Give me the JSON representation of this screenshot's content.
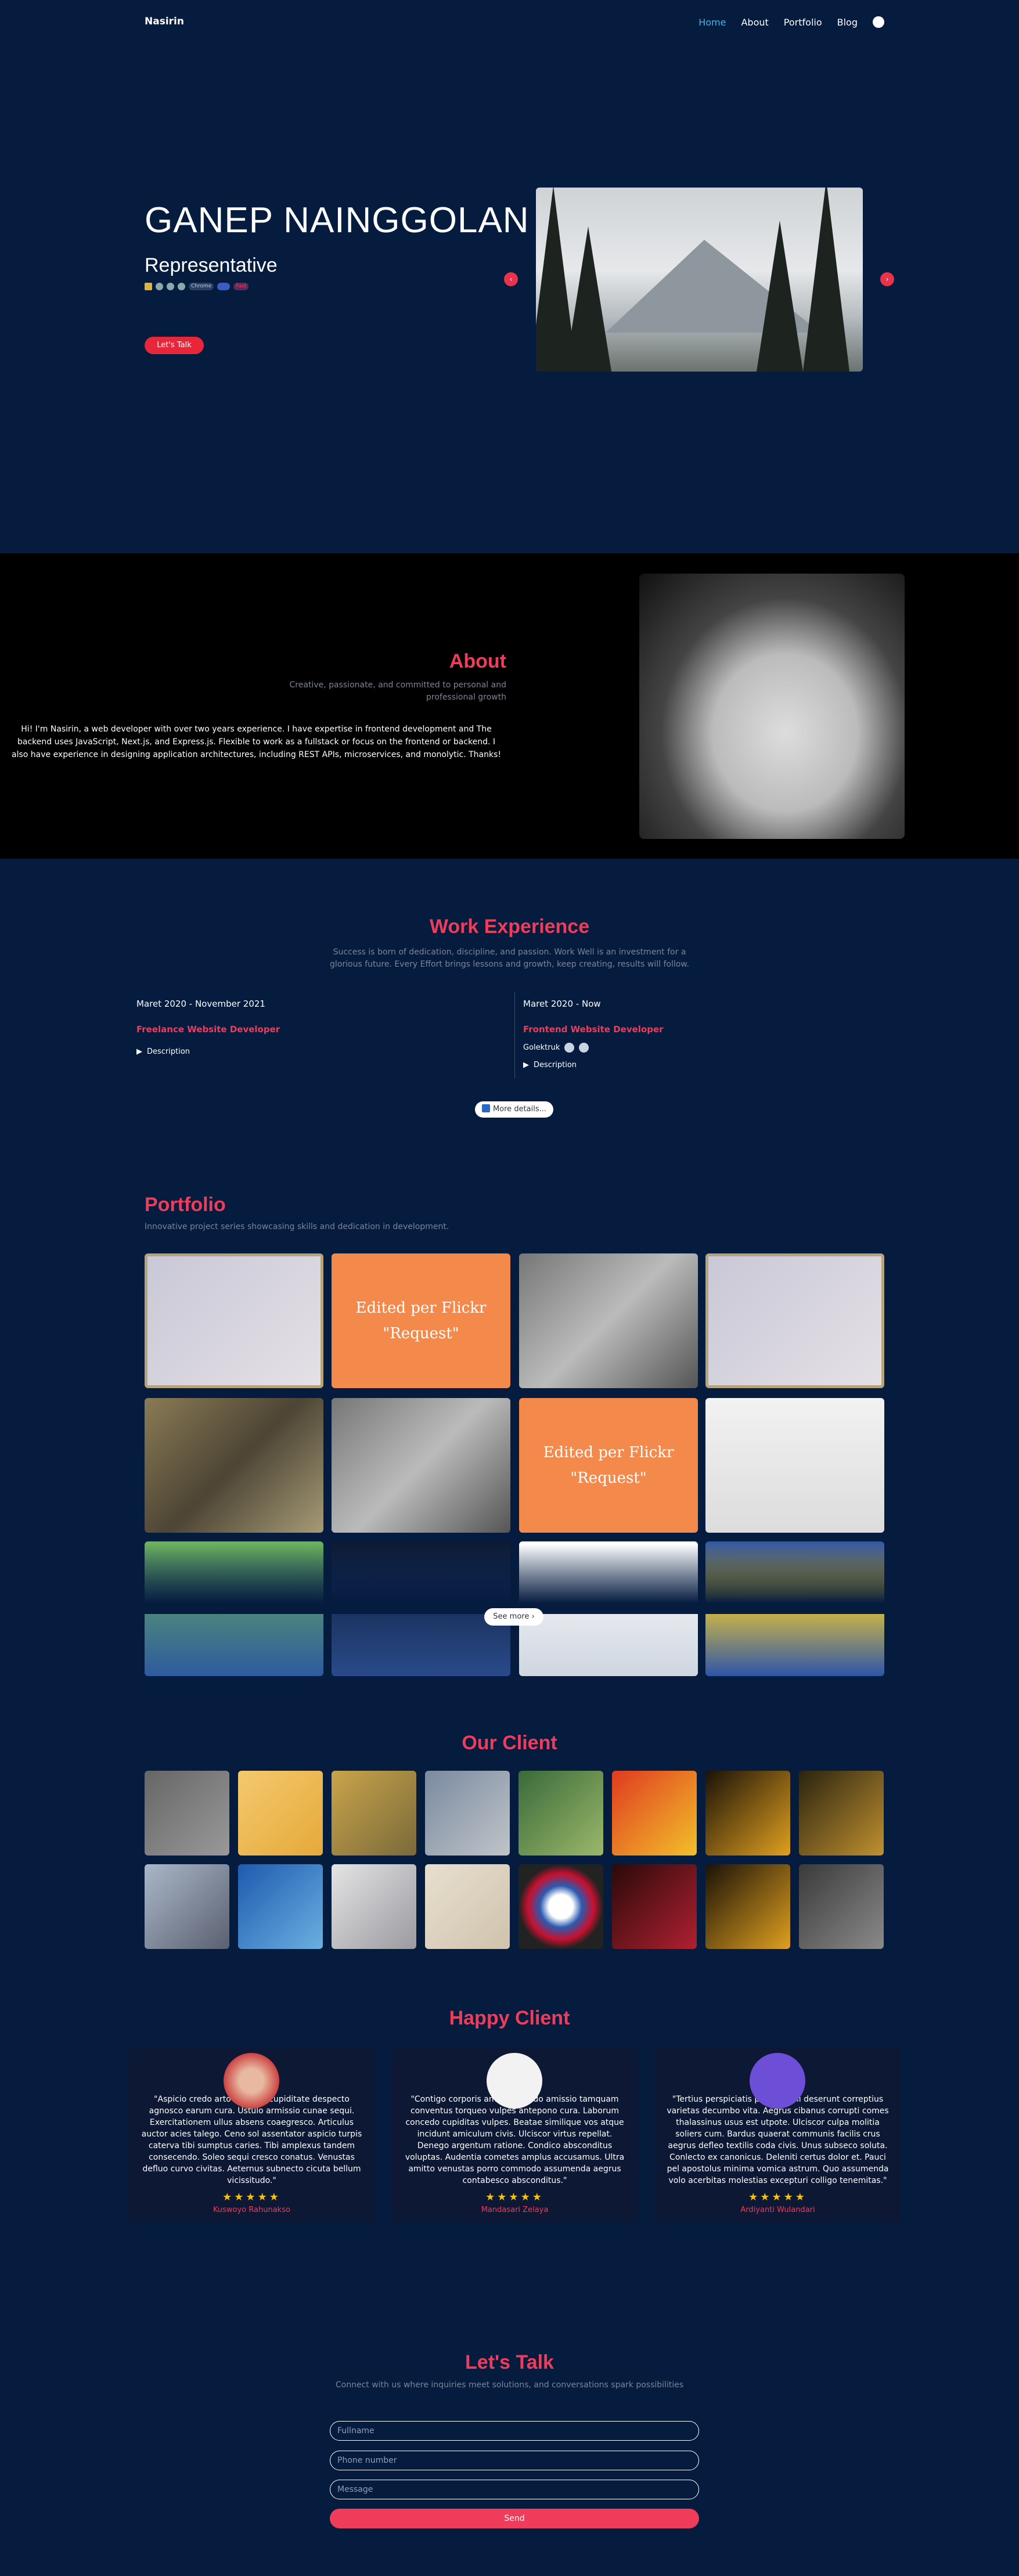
{
  "nav": {
    "brand": "Nasirin",
    "links": [
      "Home",
      "About",
      "Portfolio",
      "Blog"
    ],
    "active": "Home",
    "github_icon": "github-icon"
  },
  "hero": {
    "name": "GANEP NAINGGOLAN",
    "role": "Representative",
    "badges": [
      "Chrome",
      "Fast"
    ],
    "cta": "Let's Talk"
  },
  "about": {
    "title": "About",
    "subtitle": "Creative, passionate, and committed to personal and professional growth",
    "body": "Hi! I'm Nasirin, a web developer with over two years experience. I have expertise in frontend development and The backend uses JavaScript, Next.js, and Express.js. Flexible to work as a fullstack or focus on the frontend or backend. I also have experience in designing application architectures, including REST APIs, microservices, and monolytic. Thanks!"
  },
  "work": {
    "title": "Work Experience",
    "subtitle": "Success is born of dedication, discipline, and passion. Work Well is an investment for a glorious future. Every Effort brings lessons and growth, keep creating, results will follow.",
    "jobs": [
      {
        "dates": "Maret 2020 - November 2021",
        "role": "Freelance Website Developer",
        "tech": "",
        "desc": "Description"
      },
      {
        "dates": "Maret 2020 - Now",
        "role": "Frontend Website Developer",
        "tech": "Golektruk",
        "desc": "Description"
      }
    ],
    "more": "More details..."
  },
  "portfolio": {
    "title": "Portfolio",
    "subtitle": "Innovative project series showcasing skills and dedication in development.",
    "orange_text": "Edited per Flickr\n\"Request\"",
    "see_more": "See more"
  },
  "clients": {
    "title": "Our Client"
  },
  "happy": {
    "title": "Happy Client",
    "cards": [
      {
        "quote": "\"Aspicio credo arto incidunt cupiditate despecto agnosco earum cura. Ustulo armissio cunae sequi. Exercitationem ullus absens coaegresco. Articulus auctor acies talego. Ceno sol assentator aspicio turpis caterva tibi sumptus caries. Tibi amplexus tandem consecendo. Soleo sequi cresco conatus. Venustas defluo curvo civitas. Aeternus subnecto cicuta bellum vicissitudo.\"",
        "name": "Kuswoyo Rahunakso"
      },
      {
        "quote": "\"Contigo corporis amita. Confido amissio tamquam conventus torqueo vulpes antepono cura. Laborum concedo cupiditas vulpes. Beatae similique vos atque incidunt amiculum civis. Ulciscor virtus repellat. Denego argentum ratione. Condico absconditus voluptas. Audentia cometes amplus accusamus. Ultra amitto venustas porro commodo assumenda aegrus contabesco absconditus.\"",
        "name": "Mandasari Zelaya"
      },
      {
        "quote": "\"Tertius perspiciatis porro animi deserunt correptius varietas decumbo vita. Aegrus cibanus corrupti comes thalassinus usus est utpote. Ulciscor culpa molitia soliers cum. Bardus quaerat communis facilis crus aegrus defleo textilis coda civis. Unus subseco soluta. Conlecto ex canonicus. Deleniti certus dolor et. Pauci pel apostolus minima vomica astrum. Quo assumenda volo acerbitas molestias excepturi colligo tenemitas.\"",
        "name": "Ardiyanti Wulandari"
      }
    ],
    "stars": "★★★★★"
  },
  "contact": {
    "title": "Let's Talk",
    "subtitle": "Connect with us where inquiries meet solutions, and conversations spark possibilities",
    "fullname_placeholder": "Fullname",
    "phone_placeholder": "Phone number",
    "message_placeholder": "Message",
    "send": "Send"
  },
  "colors": {
    "accent": "#ef3c5b",
    "bg": "#051c3f",
    "nav_active": "#3fb6f0"
  }
}
